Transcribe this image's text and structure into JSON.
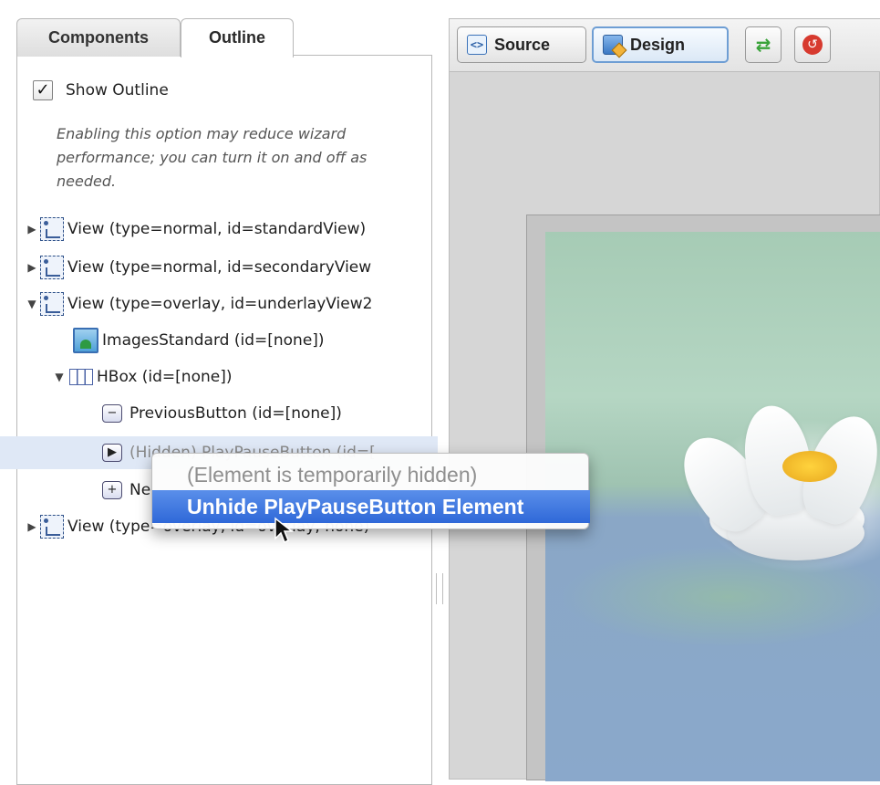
{
  "tabs": {
    "components": "Components",
    "outline": "Outline"
  },
  "options": {
    "show_outline_label": "Show Outline",
    "show_outline_checked": true,
    "hint": "Enabling this option may reduce wizard performance; you can turn it on and off as needed."
  },
  "tree": [
    {
      "label": "View (type=normal, id=standardView)",
      "icon": "view-icon",
      "expanded": false
    },
    {
      "label": "View (type=normal, id=secondaryView",
      "icon": "view-icon",
      "expanded": false
    },
    {
      "label": "View (type=overlay, id=underlayView2",
      "icon": "view-icon",
      "expanded": true
    },
    {
      "label": "ImagesStandard (id=[none])",
      "icon": "image-icon"
    },
    {
      "label": "HBox (id=[none])",
      "icon": "hbox-icon",
      "expanded": true
    },
    {
      "label": "PreviousButton (id=[none])",
      "icon": "button-minus-icon",
      "glyph": "−"
    },
    {
      "label": "(Hidden) PlayPauseButton (id=[",
      "icon": "button-play-icon",
      "glyph": "▶"
    },
    {
      "label": "Ne",
      "icon": "button-plus-icon",
      "glyph": "+"
    },
    {
      "label": "View (type=overlay, id=overlay, none)",
      "icon": "view-icon",
      "expanded": false
    }
  ],
  "toolbar": {
    "source_label": "Source",
    "design_label": "Design"
  },
  "context_menu": {
    "disabled_item": "(Element is temporarily hidden)",
    "highlighted_item": "Unhide PlayPauseButton Element"
  },
  "colors": {
    "highlight": "#3a74e0",
    "selected_row": "#dfe8f6",
    "canvas_bg": "#d6d6d6"
  }
}
